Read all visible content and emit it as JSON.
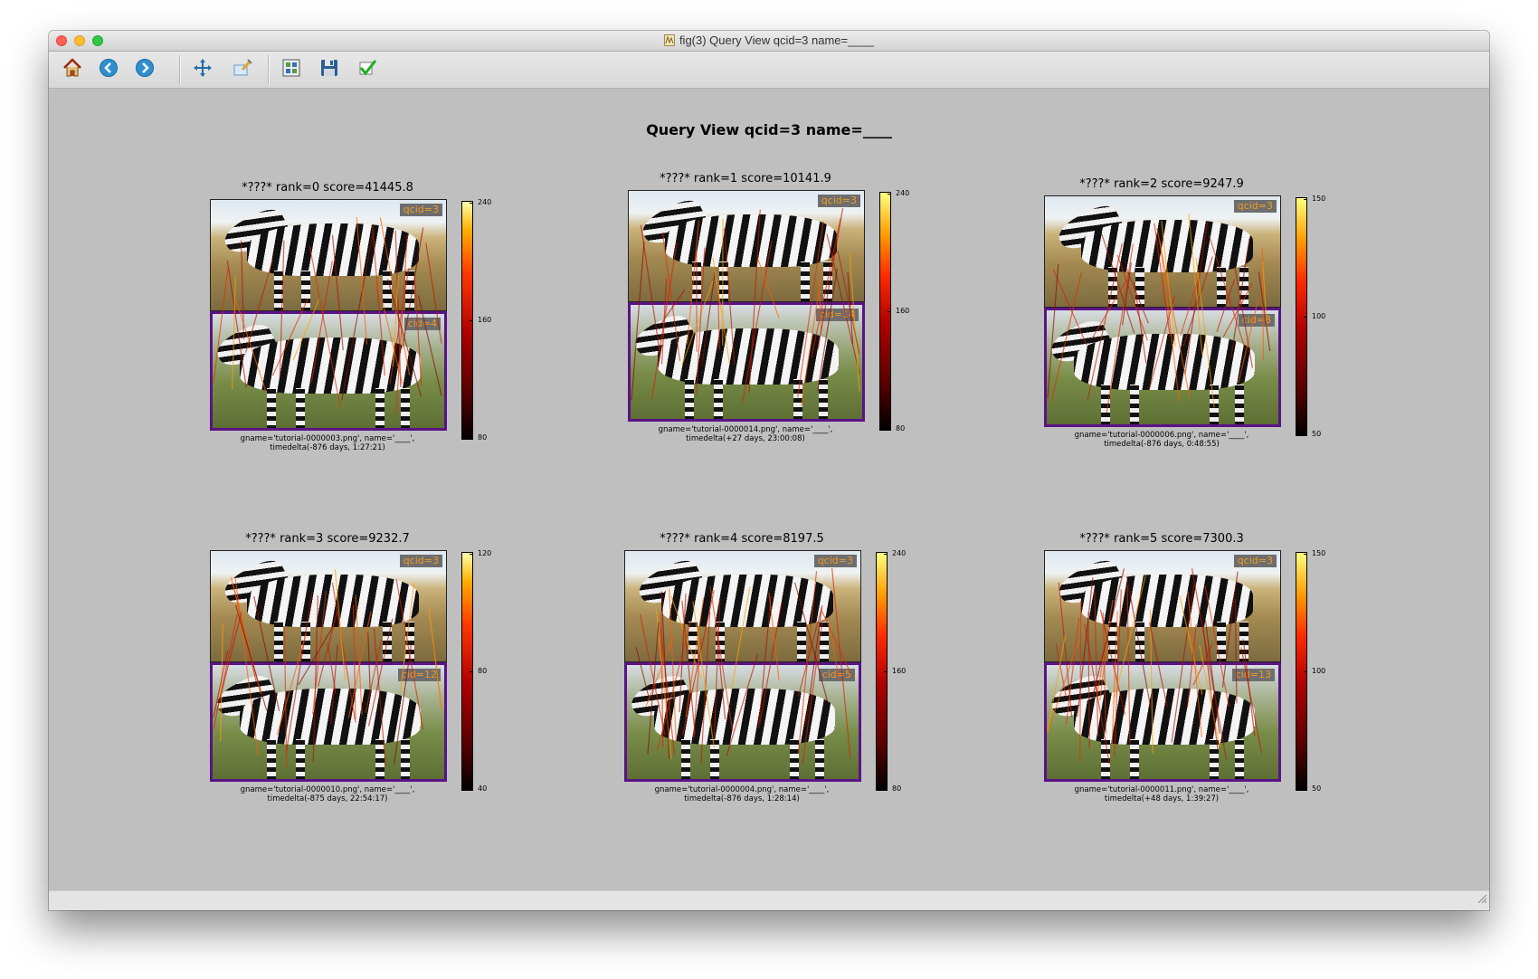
{
  "window": {
    "title": "fig(3) Query View  qcid=3 name=____"
  },
  "toolbar": {
    "buttons": [
      {
        "name": "home",
        "icon": "home-icon"
      },
      {
        "name": "back",
        "icon": "back-arrow-icon"
      },
      {
        "name": "forward",
        "icon": "forward-arrow-icon"
      },
      {
        "name": "pan",
        "icon": "pan-move-icon"
      },
      {
        "name": "zoom",
        "icon": "zoom-rect-icon"
      },
      {
        "name": "subplots",
        "icon": "configure-subplots-icon"
      },
      {
        "name": "save",
        "icon": "floppy-save-icon"
      },
      {
        "name": "edit",
        "icon": "checkmark-icon"
      }
    ]
  },
  "figure": {
    "title": "Query View  qcid=3 name=____"
  },
  "panels": [
    {
      "title": "*???* rank=0 score=41445.8",
      "query_label": "qcid=3",
      "match_label": "cid=4",
      "caption_line1": "gname='tutorial-0000003.png', name='____',",
      "caption_line2": "timedelta(-876 days, 1:27:21)",
      "cbar_top": "240",
      "cbar_mid": "160",
      "cbar_bot": "80"
    },
    {
      "title": "*???* rank=1 score=10141.9",
      "query_label": "qcid=3",
      "match_label": "cid=14",
      "caption_line1": "gname='tutorial-0000014.png', name='____',",
      "caption_line2": "timedelta(+27 days, 23:00:08)",
      "cbar_top": "240",
      "cbar_mid": "160",
      "cbar_bot": "80"
    },
    {
      "title": "*???* rank=2 score=9247.9",
      "query_label": "qcid=3",
      "match_label": "cid=8",
      "caption_line1": "gname='tutorial-0000006.png', name='____',",
      "caption_line2": "timedelta(-876 days, 0:48:55)",
      "cbar_top": "150",
      "cbar_mid": "100",
      "cbar_bot": "50"
    },
    {
      "title": "*???* rank=3 score=9232.7",
      "query_label": "qcid=3",
      "match_label": "cid=12",
      "caption_line1": "gname='tutorial-0000010.png', name='____',",
      "caption_line2": "timedelta(-875 days, 22:54:17)",
      "cbar_top": "120",
      "cbar_mid": "80",
      "cbar_bot": "40"
    },
    {
      "title": "*???* rank=4 score=8197.5",
      "query_label": "qcid=3",
      "match_label": "cid=5",
      "caption_line1": "gname='tutorial-0000004.png', name='____',",
      "caption_line2": "timedelta(-876 days, 1:28:14)",
      "cbar_top": "240",
      "cbar_mid": "160",
      "cbar_bot": "80"
    },
    {
      "title": "*???* rank=5 score=7300.3",
      "query_label": "qcid=3",
      "match_label": "cid=13",
      "caption_line1": "gname='tutorial-0000011.png', name='____',",
      "caption_line2": "timedelta(+48 days, 1:39:27)",
      "cbar_top": "150",
      "cbar_mid": "100",
      "cbar_bot": "50"
    }
  ],
  "colors": {
    "match_box": "#5a1386",
    "label_text": "#f29a1f",
    "figure_bg": "#bfbfbf"
  }
}
